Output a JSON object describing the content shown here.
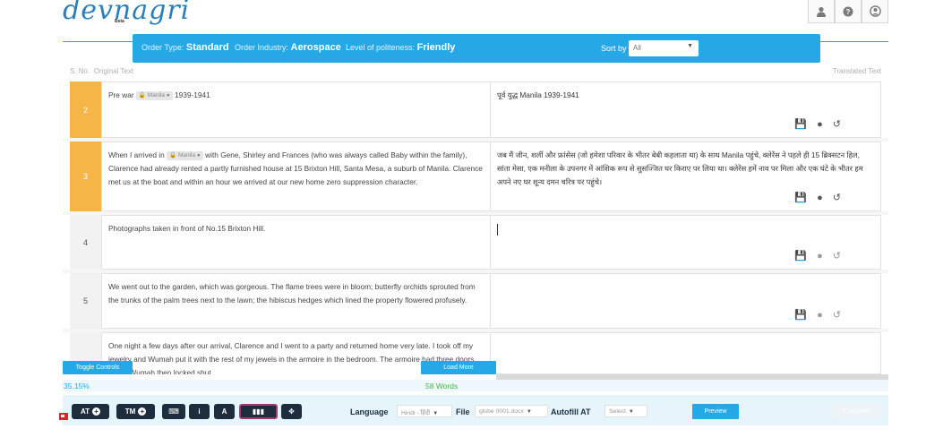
{
  "header": {
    "logo": "devnagri",
    "beta": "Beta",
    "icons": [
      "user-icon",
      "help-icon",
      "profile-icon"
    ]
  },
  "infobar": {
    "order_type_label": "Order Type:",
    "order_type": "Standard",
    "industry_label": "Order Industry:",
    "industry": "Aerospace",
    "politeness_label": "Level of politeness:",
    "politeness": "Friendly",
    "sort_label": "Sort by",
    "sort_value": "All"
  },
  "columns": {
    "sno": "S. No.",
    "original": "Original Text",
    "translated": "Translated Text"
  },
  "rows": [
    {
      "num": "2",
      "src_before": "Pre war",
      "tag": "Manila",
      "src_after": "1939-1941",
      "tgt": "पूर्व युद्ध Manila 1939-1941"
    },
    {
      "num": "3",
      "src_before": "When I arrived in",
      "tag": "Manila",
      "src_after": "with Gene, Shirley and Frances (who was always called Baby within the family), Clarence had already rented a partly furnished house at 15 Brixton Hill, Santa Mesa, a suburb of Manila. Clarence met us at the boat and within an hour we arrived at our new home zero suppression character.",
      "tgt": "जब मैं जीन, शर्ली और फ्रांसेस (जो हमेशा परिवार के भीतर बेबी कहलाता था) के साथ Manila पहुंचे, क्लेरेंस ने पहले ही 15 ब्रिक्सटन हिल, सांता मेसा, एक मनीला के उपनगर में आंशिक रूप से सुसज्जित घर किराए पर लिया था। क्लेरेंस हमें नाव पर मिला और एक घंटे के भीतर हम अपने नए घर शून्य दमन चरित्र पर पहुंचे।"
    },
    {
      "num": "4",
      "src": "Photographs taken in front of No.15 Brixton Hill.",
      "tgt": ""
    },
    {
      "num": "5",
      "src": "We went out to the garden, which was gorgeous. The flame trees were in bloom; butterfly orchids sprouted from the trunks of the palm trees next to the lawn; the hibiscus hedges which lined the property flowered profusely.",
      "tgt": ""
    },
    {
      "num": "",
      "src": "One night a few days after our arrival, Clarence and I went to a party and returned home very late. I took off my jewelry and Wumah put it with the rest of my jewels in the armoire in the bedroom. The armoire had three doors, which Wumah then locked shut.",
      "tgt": ""
    }
  ],
  "bottom": {
    "toggle_controls": "Toggle Controls",
    "load_more": "Load More",
    "progress": "35.15%",
    "words": "58 Words"
  },
  "toolbar": {
    "at": "AT",
    "tm": "TM",
    "info": "i",
    "font": "A",
    "language_label": "Language",
    "language_value": "Hindi - हिंदी",
    "file_label": "File",
    "file_value": "globe 0001.docx",
    "autofill_label": "Autofill AT",
    "autofill_value": "Select",
    "preview": "Preview",
    "complete": "Complete"
  }
}
